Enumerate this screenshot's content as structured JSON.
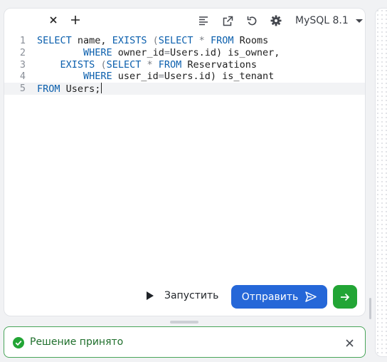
{
  "toolbar": {
    "tab_close_icon": "close-icon",
    "tab_add_icon": "plus-icon",
    "format_icon": "format-lines-icon",
    "open_icon": "external-link-icon",
    "reset_icon": "undo-icon",
    "settings_icon": "gear-icon",
    "dialect": "MySQL 8.1"
  },
  "editor": {
    "lines": [
      {
        "number": "1",
        "tokens": [
          [
            "kw",
            "SELECT"
          ],
          [
            "t",
            " name, "
          ],
          [
            "kw",
            "EXISTS"
          ],
          [
            "t",
            " "
          ],
          [
            "op",
            "("
          ],
          [
            "kw",
            "SELECT"
          ],
          [
            "t",
            " "
          ],
          [
            "op",
            "*"
          ],
          [
            "t",
            " "
          ],
          [
            "kw",
            "FROM"
          ],
          [
            "t",
            " Rooms"
          ]
        ]
      },
      {
        "number": "2",
        "tokens": [
          [
            "t",
            "        "
          ],
          [
            "kw",
            "WHERE"
          ],
          [
            "t",
            " owner_id"
          ],
          [
            "op",
            "="
          ],
          [
            "t",
            "Users.id) is_owner,"
          ]
        ]
      },
      {
        "number": "3",
        "tokens": [
          [
            "t",
            "    "
          ],
          [
            "kw",
            "EXISTS"
          ],
          [
            "t",
            " "
          ],
          [
            "op",
            "("
          ],
          [
            "kw",
            "SELECT"
          ],
          [
            "t",
            " "
          ],
          [
            "op",
            "*"
          ],
          [
            "t",
            " "
          ],
          [
            "kw",
            "FROM"
          ],
          [
            "t",
            " Reservations"
          ]
        ]
      },
      {
        "number": "4",
        "tokens": [
          [
            "t",
            "        "
          ],
          [
            "kw",
            "WHERE"
          ],
          [
            "t",
            " user_id"
          ],
          [
            "op",
            "="
          ],
          [
            "t",
            "Users.id) is_tenant"
          ]
        ]
      },
      {
        "number": "5",
        "tokens": [
          [
            "kw",
            "FROM"
          ],
          [
            "t",
            " Users;"
          ]
        ]
      }
    ]
  },
  "actions": {
    "run_label": "Запустить",
    "submit_label": "Отправить",
    "submit_icon": "send-icon",
    "next_icon": "arrow-right-icon"
  },
  "status": {
    "message": "Решение принято",
    "icon": "check-circle-icon",
    "close_icon": "close-icon"
  },
  "colors": {
    "keyword": "#0b5fad",
    "submit": "#2567d8",
    "next": "#22a535",
    "success_border": "#49a55a",
    "success_text": "#1f6f2c"
  }
}
